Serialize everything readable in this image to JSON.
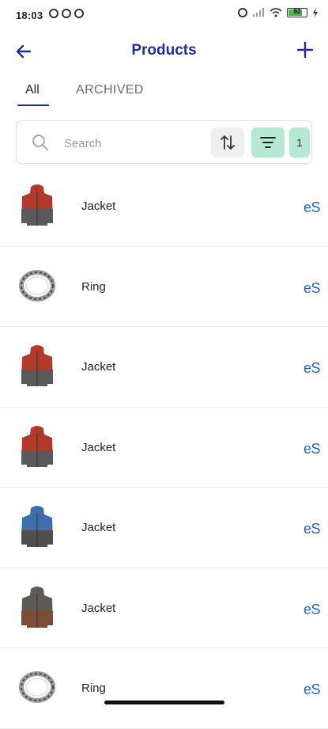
{
  "status": {
    "time": "18:03",
    "battery": "92"
  },
  "appbar": {
    "title": "Products"
  },
  "tabs": [
    {
      "label": "All",
      "selected": true
    },
    {
      "label": "ARCHIVED",
      "selected": false
    }
  ],
  "search": {
    "placeholder": "Search",
    "filter_count": "1"
  },
  "products": [
    {
      "name": "Jacket",
      "brand": "eS",
      "image": "jacket-red"
    },
    {
      "name": "Ring",
      "brand": "eS",
      "image": "ring"
    },
    {
      "name": "Jacket",
      "brand": "eS",
      "image": "jacket-red"
    },
    {
      "name": "Jacket",
      "brand": "eS",
      "image": "jacket-red"
    },
    {
      "name": "Jacket",
      "brand": "eS",
      "image": "jacket-blue"
    },
    {
      "name": "Jacket",
      "brand": "eS",
      "image": "jacket-brown"
    },
    {
      "name": "Ring",
      "brand": "eS",
      "image": "ring"
    }
  ],
  "colors": {
    "accent": "#1f2f8f",
    "brand_text": "#2a63b5",
    "filter_bg": "#b7e8d4"
  }
}
